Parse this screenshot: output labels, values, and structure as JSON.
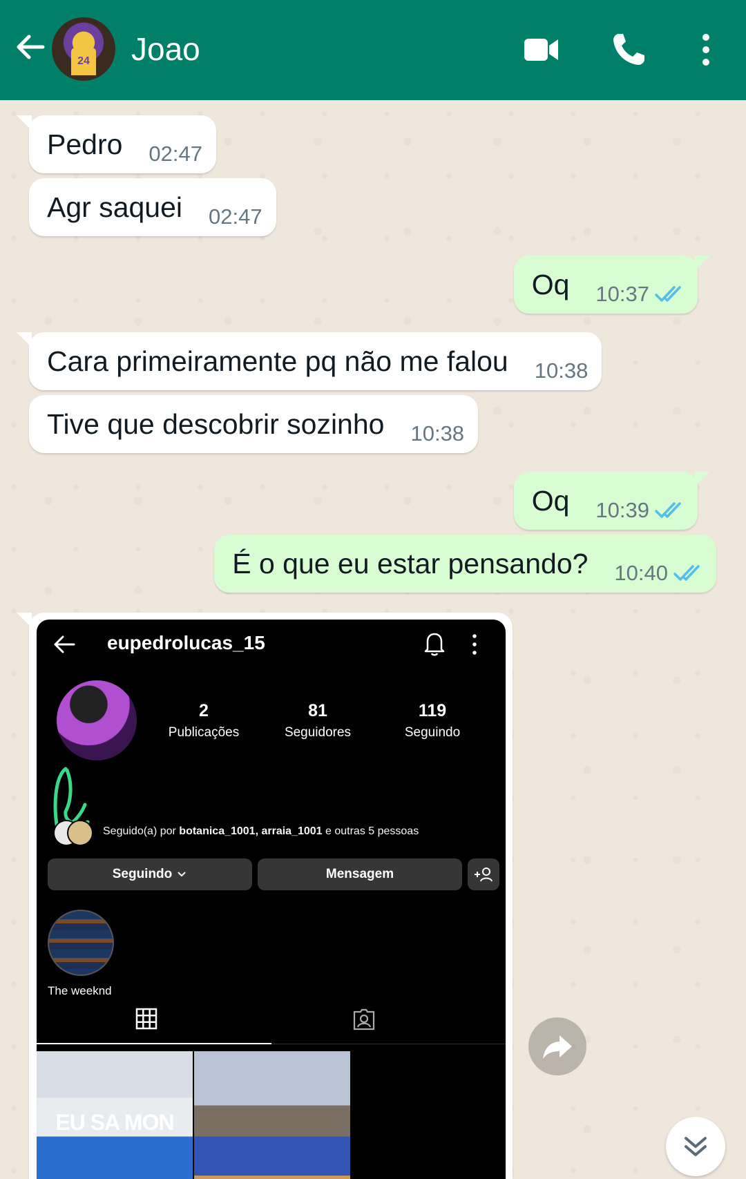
{
  "header": {
    "contact_name": "Joao",
    "avatar_jersey_number": "24",
    "color": "#008069"
  },
  "messages": [
    {
      "dir": "in",
      "text": "Pedro",
      "time": "02:47"
    },
    {
      "dir": "in",
      "text": "Agr saquei",
      "time": "02:47"
    },
    {
      "dir": "out",
      "text": "Oq",
      "time": "10:37",
      "status": "read"
    },
    {
      "dir": "in",
      "text": "Cara primeiramente pq não me falou",
      "time": "10:38"
    },
    {
      "dir": "in",
      "text": "Tive que descobrir sozinho",
      "time": "10:38"
    },
    {
      "dir": "out",
      "text": "Oq",
      "time": "10:39",
      "status": "read"
    },
    {
      "dir": "out",
      "text": "É o que eu estar pensando?",
      "time": "10:40",
      "status": "read"
    }
  ],
  "screenshot": {
    "username": "eupedrolucas_15",
    "stats": [
      {
        "num": "2",
        "label": "Publicações"
      },
      {
        "num": "81",
        "label": "Seguidores"
      },
      {
        "num": "119",
        "label": "Seguindo"
      }
    ],
    "followed_prefix": "Seguido(a) por ",
    "followed_names": "botanica_1001, arraia_1001",
    "followed_suffix": " e outras 5 pessoas",
    "btn_following": "Seguindo",
    "btn_message": "Mensagem",
    "highlight_label": "The weeknd",
    "post1_text": "EU SA  MON"
  },
  "colors": {
    "incoming": "#ffffff",
    "outgoing": "#d9fdd3",
    "read_ticks": "#53bdeb"
  }
}
